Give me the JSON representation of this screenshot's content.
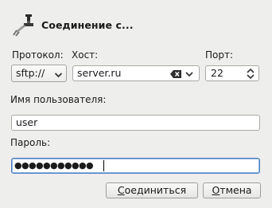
{
  "dialog": {
    "title": "Соединение с..."
  },
  "protocol": {
    "label": "Протокол:",
    "value": "sftp://"
  },
  "host": {
    "label": "Хост:",
    "value": "server.ru"
  },
  "port": {
    "label": "Порт:",
    "value": "22"
  },
  "username": {
    "label": "Имя пользователя:",
    "value": "user"
  },
  "password": {
    "label": "Пароль:",
    "mask": "●●●●●●●●●●●"
  },
  "buttons": {
    "connect_mnemonic": "С",
    "connect_rest": "оединиться",
    "cancel_mnemonic": "О",
    "cancel_rest": "тмена"
  },
  "icons": {
    "app": "connect-plug-icon",
    "protocol_dropdown": "chevron-down-icon",
    "host_clear": "clear-text-icon",
    "port_spin": "spin-up-down-icon"
  }
}
